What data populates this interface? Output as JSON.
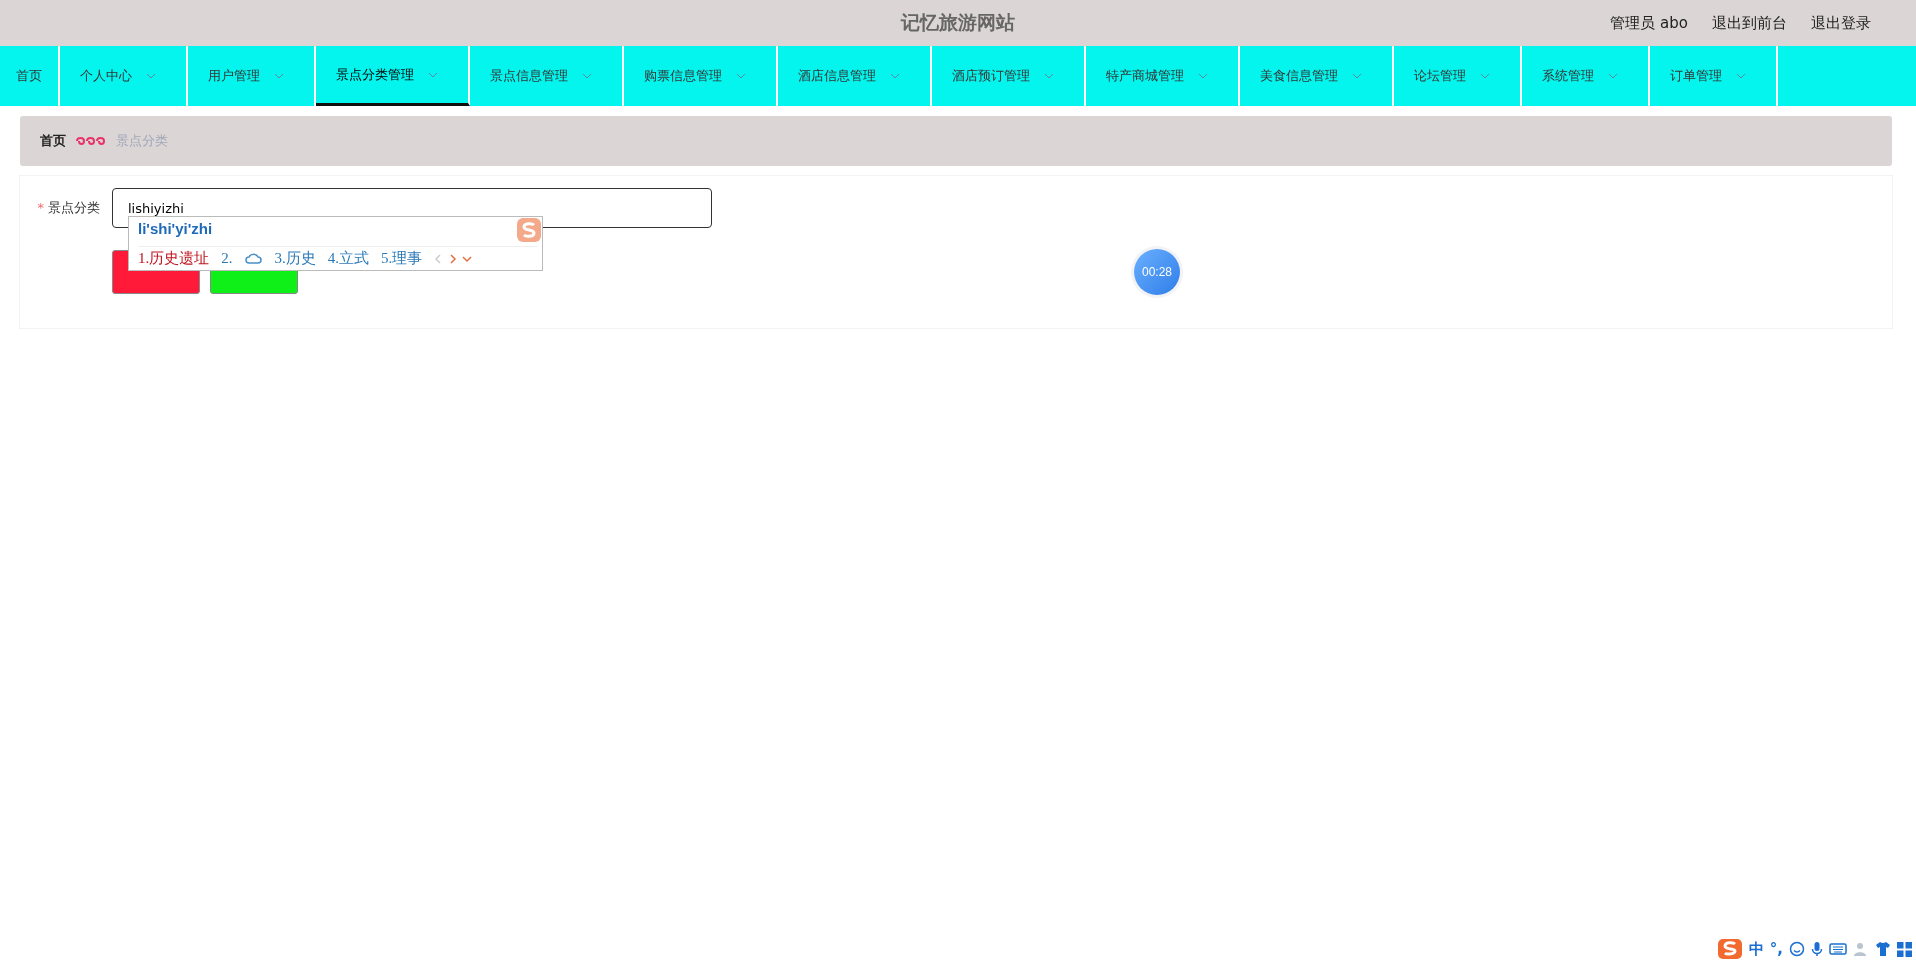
{
  "header": {
    "title": "记忆旅游网站",
    "links": [
      "管理员 abo",
      "退出到前台",
      "退出登录"
    ]
  },
  "nav": [
    {
      "label": "首页",
      "dropdown": false,
      "selected": false
    },
    {
      "label": "个人中心",
      "dropdown": true,
      "selected": false
    },
    {
      "label": "用户管理",
      "dropdown": true,
      "selected": false
    },
    {
      "label": "景点分类管理",
      "dropdown": true,
      "selected": true
    },
    {
      "label": "景点信息管理",
      "dropdown": true,
      "selected": false
    },
    {
      "label": "购票信息管理",
      "dropdown": true,
      "selected": false
    },
    {
      "label": "酒店信息管理",
      "dropdown": true,
      "selected": false
    },
    {
      "label": "酒店预订管理",
      "dropdown": true,
      "selected": false
    },
    {
      "label": "特产商城管理",
      "dropdown": true,
      "selected": false
    },
    {
      "label": "美食信息管理",
      "dropdown": true,
      "selected": false
    },
    {
      "label": "论坛管理",
      "dropdown": true,
      "selected": false
    },
    {
      "label": "系统管理",
      "dropdown": true,
      "selected": false
    },
    {
      "label": "订单管理",
      "dropdown": true,
      "selected": false
    }
  ],
  "breadcrumb": {
    "home": "首页",
    "current": "景点分类"
  },
  "form": {
    "label": "景点分类",
    "required_mark": "*",
    "value": "lishiyizhi",
    "buttons": [
      {
        "kind": "submit"
      },
      {
        "kind": "cancel"
      }
    ]
  },
  "ime": {
    "composition": "li'shi'yi'zhi",
    "candidates": [
      {
        "text": "1.历史遗址",
        "selected": true
      },
      {
        "text": "2.",
        "selected": false
      },
      {
        "text": "3.历史",
        "selected": false
      },
      {
        "text": "4.立式",
        "selected": false
      },
      {
        "text": "5.理事",
        "selected": false
      }
    ],
    "toolbar": [
      "中",
      "°,"
    ]
  },
  "timer": "00:28"
}
